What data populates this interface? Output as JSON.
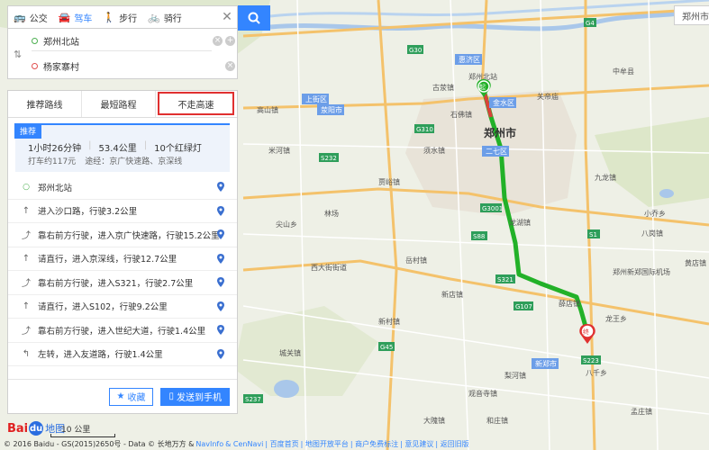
{
  "modes": [
    {
      "label": "公交",
      "icon": "bus-icon",
      "active": false
    },
    {
      "label": "驾车",
      "icon": "car-icon",
      "active": true
    },
    {
      "label": "步行",
      "icon": "walk-icon",
      "active": false
    },
    {
      "label": "骑行",
      "icon": "bike-icon",
      "active": false
    }
  ],
  "inputs": {
    "start": "郑州北站",
    "end": "杨家寨村"
  },
  "tabs": [
    "推荐路线",
    "最短路程",
    "不走高速"
  ],
  "summary": {
    "badge": "推荐",
    "duration": "1小时26分钟",
    "distance": "53.4公里",
    "lights": "10个红绿灯",
    "taxi": "打车约117元",
    "via": "途经：京广快速路、京深线"
  },
  "steps": [
    "郑州北站",
    "进入沙口路，行驶3.2公里",
    "靠右前方行驶，进入京广快速路，行驶15.2公里",
    "请直行，进入京深线，行驶12.7公里",
    "靠右前方行驶，进入S321，行驶2.7公里",
    "请直行，进入S102，行驶9.2公里",
    "靠右前方行驶，进入世纪大道，行驶1.4公里",
    "左转，进入友道路，行驶1.4公里"
  ],
  "buttons": {
    "favorite": "收藏",
    "send": "发送到手机"
  },
  "city": "郑州市",
  "scale": "10 公里",
  "logo": {
    "bai": "Bai",
    "du": "du",
    "ditu": "地图"
  },
  "copyright": {
    "text": "© 2016 Baidu - GS(2015)2650号 - Data © 长地万方 &",
    "links": [
      "NavInfo",
      "& CenNavi",
      "| 百度首页",
      "| 地图开放平台",
      "| 商户免费标注",
      "| 意见建议",
      "| 返回旧版"
    ]
  },
  "map_labels": {
    "zhengzhou": "郑州市",
    "districts": [
      "惠济区",
      "金水区",
      "上街区",
      "荥阳市",
      "二七区",
      "新郑市",
      "郑州新郑国际机场"
    ],
    "start_marker": "起",
    "end_marker": "终",
    "places": [
      "九龙镇",
      "关帝庙",
      "须水镇",
      "尖山乡",
      "贾峪镇",
      "西大街街道",
      "龙湖镇",
      "八千乡",
      "龙王乡",
      "小乔乡",
      "黄店镇",
      "八岗镇",
      "高山镇",
      "米河镇",
      "古荥镇",
      "中牟县",
      "新村镇",
      "岳村镇",
      "梨河镇",
      "孟庄镇",
      "薛店镇",
      "和庄镇",
      "观音寺镇",
      "新店镇",
      "大隗镇",
      "城关镇",
      "林场",
      "郑州北站",
      "石佛镇"
    ],
    "roads": [
      "G30",
      "G310",
      "G3001",
      "G107",
      "S321",
      "S1",
      "G4",
      "S88",
      "S232",
      "S223",
      "G45",
      "S237"
    ]
  }
}
